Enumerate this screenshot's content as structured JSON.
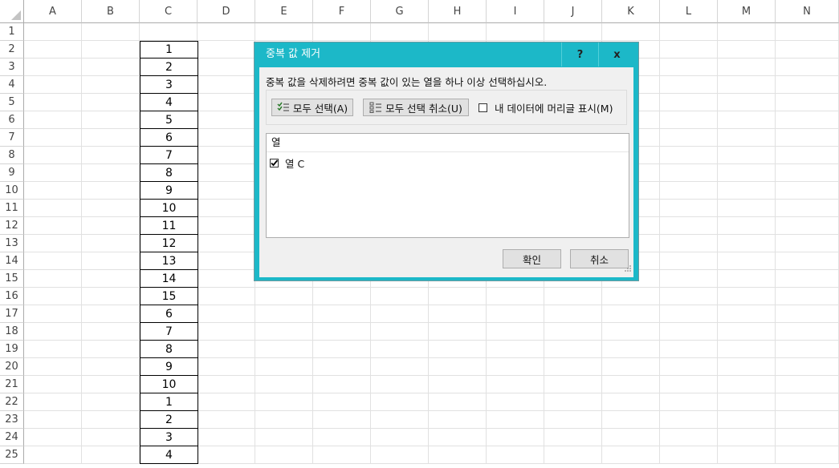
{
  "sheet": {
    "columns": [
      "A",
      "B",
      "C",
      "D",
      "E",
      "F",
      "G",
      "H",
      "I",
      "J",
      "K",
      "L",
      "M",
      "N"
    ],
    "rows": [
      "1",
      "2",
      "3",
      "4",
      "5",
      "6",
      "7",
      "8",
      "9",
      "10",
      "11",
      "12",
      "13",
      "14",
      "15",
      "16",
      "17",
      "18",
      "19",
      "20",
      "21",
      "22",
      "23",
      "24",
      "25"
    ],
    "column_c_values": [
      "1",
      "2",
      "3",
      "4",
      "5",
      "6",
      "7",
      "8",
      "9",
      "10",
      "11",
      "12",
      "13",
      "14",
      "15",
      "6",
      "7",
      "8",
      "9",
      "10",
      "1",
      "2",
      "3",
      "4"
    ]
  },
  "dialog": {
    "title": "중복 값 제거",
    "help_label": "?",
    "close_label": "x",
    "prompt": "중복 값을 삭제하려면 중복 값이 있는 열을 하나 이상 선택하십시오.",
    "select_all_label": "모두 선택(A)",
    "unselect_all_label": "모두 선택 취소(U)",
    "header_checkbox_label": "내 데이터에 머리글 표시(M)",
    "header_checkbox_checked": false,
    "list_header": "열",
    "columns_list": [
      {
        "label": "열 C",
        "checked": true
      }
    ],
    "ok_label": "확인",
    "cancel_label": "취소"
  },
  "colors": {
    "title_bar": "#1cb8c8",
    "dialog_body": "#f0f0f0",
    "grid_line": "#e1e1e1"
  }
}
